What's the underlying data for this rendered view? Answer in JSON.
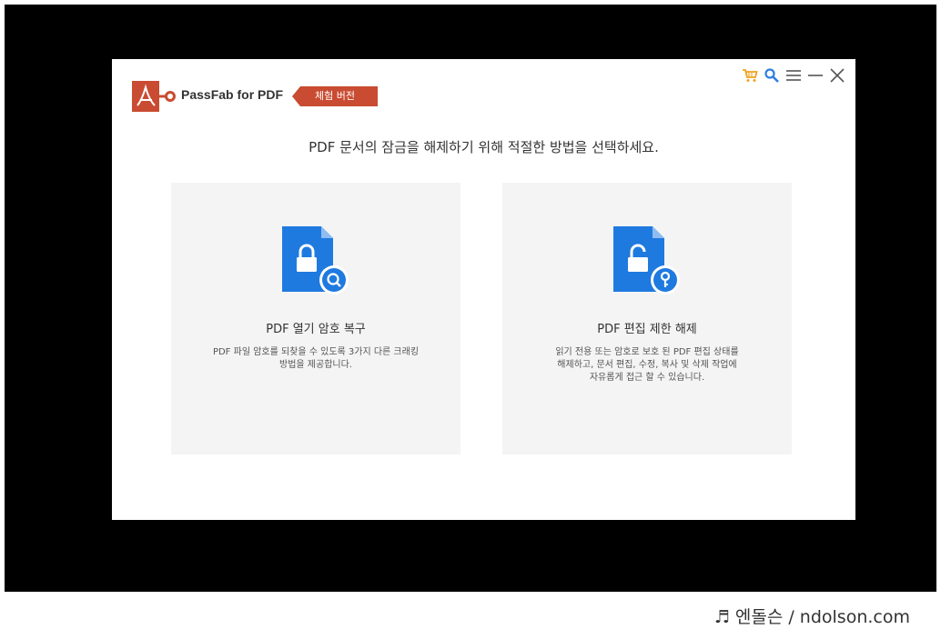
{
  "app": {
    "brand": "PassFab for PDF",
    "trial_badge": "체험 버전"
  },
  "titlebar": {
    "icons": [
      "cart-icon",
      "search-icon",
      "menu-icon",
      "minimize-icon",
      "close-icon"
    ]
  },
  "main": {
    "heading": "PDF 문서의 잠금을 해제하기 위해 적절한 방법을 선택하세요.",
    "cards": [
      {
        "icon": "pdf-lock-search-icon",
        "title": "PDF 열기 암호 복구",
        "description_lines": [
          "PDF 파일 암호를 되찾을 수 있도록 3가지 다른 크래킹",
          "방법을 제공합니다."
        ]
      },
      {
        "icon": "pdf-lock-key-icon",
        "title": "PDF 편집 제한 해제",
        "description_lines": [
          "읽기 전용 또는 암호로 보호 된 PDF 편집 상태를",
          "해제하고, 문서 편집, 수정, 복사 및 삭제 작업에",
          "자유롭게 접근 할 수 있습니다."
        ]
      }
    ]
  },
  "watermark": {
    "text": "♬ 엔돌슨 / ndolson.com"
  },
  "colors": {
    "brand_red": "#c94b31",
    "accent_orange": "#f0a020",
    "accent_blue": "#2d7fe0",
    "file_blue": "#1f7ae0"
  }
}
